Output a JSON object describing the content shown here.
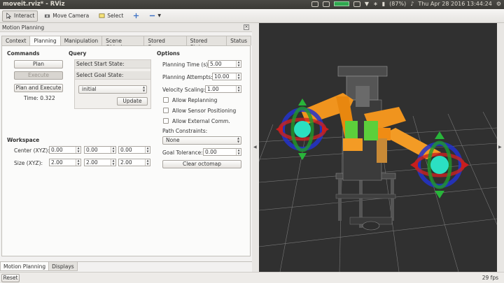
{
  "window": {
    "title": "moveit.rviz* - RViz"
  },
  "system_tray": {
    "battery": "(87%)",
    "clock": "Thu Apr 28 2016 13:44:24"
  },
  "toolbar": {
    "interact": "Interact",
    "move_camera": "Move Camera",
    "select": "Select"
  },
  "panel": {
    "title": "Motion Planning",
    "tabs": [
      "Context",
      "Planning",
      "Manipulation",
      "Scene Objects",
      "Stored Scenes",
      "Stored States",
      "Status"
    ],
    "selected_tab": "Planning"
  },
  "commands": {
    "header": "Commands",
    "plan": "Plan",
    "execute": "Execute",
    "plan_and_execute": "Plan and Execute",
    "time_label": "Time: 0.322"
  },
  "query": {
    "header": "Query",
    "start_state": "Select Start State:",
    "goal_state": "Select Goal State:",
    "state_value": "initial",
    "update": "Update"
  },
  "options": {
    "header": "Options",
    "planning_time_label": "Planning Time (s):",
    "planning_time": "5.00",
    "planning_attempts_label": "Planning Attempts:",
    "planning_attempts": "10.00",
    "velocity_scaling_label": "Velocity Scaling:",
    "velocity_scaling": "1.00",
    "allow_replanning": "Allow Replanning",
    "allow_sensor_positioning": "Allow Sensor Positioning",
    "allow_external_comm": "Allow External Comm.",
    "path_constraints_label": "Path Constraints:",
    "path_constraints": "None",
    "goal_tolerance_label": "Goal Tolerance:",
    "goal_tolerance": "0.00",
    "clear_octomap": "Clear octomap"
  },
  "workspace": {
    "header": "Workspace",
    "center_label": "Center (XYZ):",
    "center": [
      "0.00",
      "0.00",
      "0.00"
    ],
    "size_label": "Size (XYZ):",
    "size": [
      "2.00",
      "2.00",
      "2.00"
    ]
  },
  "bottom_tabs": [
    "Motion Planning",
    "Displays"
  ],
  "status": {
    "reset": "Reset",
    "fps": "29 fps"
  }
}
